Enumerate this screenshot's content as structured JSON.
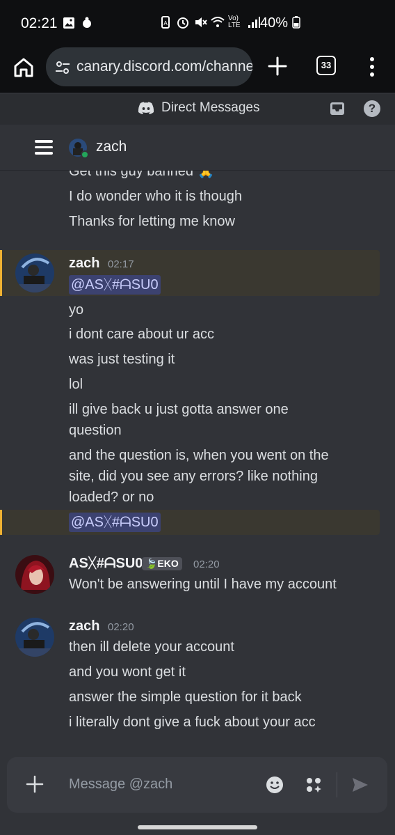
{
  "status_bar": {
    "time": "02:21",
    "battery_percent": "40%",
    "network_label": "Vo) LTE"
  },
  "browser": {
    "url": "canary.discord.com/channe",
    "tab_count": "33"
  },
  "discord": {
    "top_title": "Direct Messages",
    "channel_name": "zach",
    "composer_placeholder": "Message @zach"
  },
  "messages": {
    "partial_line": "Get this guy banned 🙏",
    "line_1": "I do wonder who it is though",
    "line_2": "Thanks for letting me know",
    "zach_1": {
      "author": "zach",
      "time": "02:17",
      "mention": "@ASᚷ#ᗩSU0",
      "lines": [
        "yo",
        "i dont care about ur acc",
        "was just testing it",
        "lol",
        "ill give back u just gotta answer one",
        "question",
        "and the question is, when you went on the",
        "site, did you see any errors? like nothing",
        "loaded? or no"
      ],
      "mention_2": "@ASᚷ#ᗩSU0"
    },
    "other_1": {
      "author": "ASᚷ#ᗩSU0",
      "badge": "🍃EKO",
      "time": "02:20",
      "lines": [
        "Won't be answering until I have my account"
      ]
    },
    "zach_2": {
      "author": "zach",
      "time": "02:20",
      "lines": [
        "then ill delete your account",
        "and you wont get it",
        "answer the simple question for it back",
        "i literally dont give a fuck about your acc"
      ]
    }
  },
  "colors": {
    "background": "#313338",
    "mention_highlight": "#3a3830",
    "mention_bar": "#f0b232",
    "mention_pill": "#3c4270"
  }
}
